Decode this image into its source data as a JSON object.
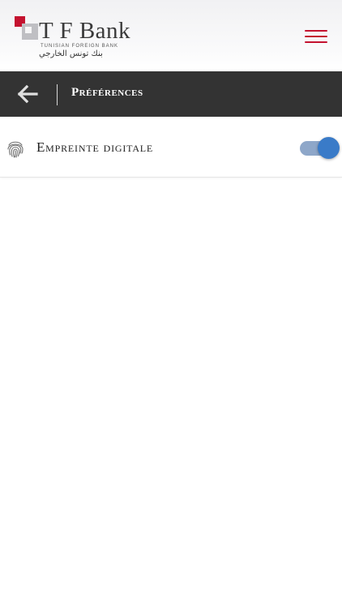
{
  "header": {
    "logo": {
      "name": "T F Bank",
      "subtitle": "TUNISIAN FOREIGN BANK",
      "arabic": "بنك تونس الخارجي"
    },
    "menu_icon": "hamburger-menu-icon",
    "brand_color": "#c4122f"
  },
  "title_bar": {
    "back_icon": "arrow-left-icon",
    "title": "Préférences",
    "background": "#333333"
  },
  "preferences": [
    {
      "icon": "fingerprint-icon",
      "label": "Empreinte digitale",
      "enabled": true,
      "toggle_color": "#3a7bc8"
    }
  ]
}
